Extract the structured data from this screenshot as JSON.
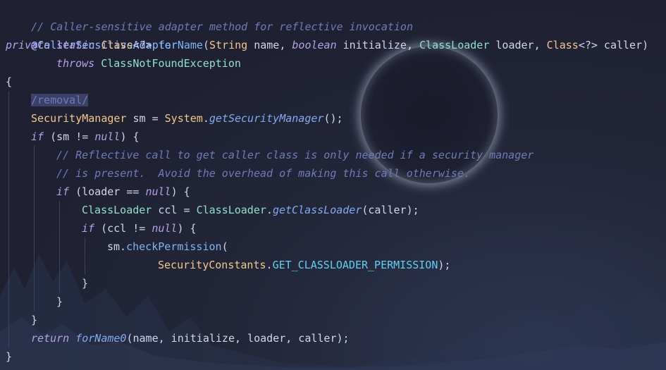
{
  "lines": {
    "l1": "// Caller-sensitive adapter method for reflective invocation",
    "l2": "@CallerSensitiveAdapter",
    "l3": {
      "kw1": "private static ",
      "t1": "Class",
      "p1": "<?> ",
      "f1": "forName",
      "p2": "(",
      "t2": "String",
      "p3": " name, ",
      "k2": "boolean",
      "p4": " initialize, ",
      "c1": "ClassLoader",
      "p5": " loader, ",
      "t3": "Class",
      "p6": "<?> caller)"
    },
    "l4": {
      "kw": "throws ",
      "c": "ClassNotFoundException"
    },
    "l5": "{",
    "l6": "/removal/",
    "l7": {
      "t": "SecurityManager",
      "p1": " sm = ",
      "t2": "System",
      "p2": ".",
      "f": "getSecurityManager",
      "p3": "();"
    },
    "l8": {
      "kw": "if",
      "p1": " (sm != ",
      "k2": "null",
      "p2": ") {"
    },
    "l9": "// Reflective call to get caller class is only needed if a security manager",
    "l10": "// is present.  Avoid the overhead of making this call otherwise.",
    "l11": {
      "kw": "if",
      "p1": " (loader == ",
      "k2": "null",
      "p2": ") {"
    },
    "l12": {
      "c1": "ClassLoader",
      "p1": " ccl = ",
      "c2": "ClassLoader",
      "p2": ".",
      "f": "getClassLoader",
      "p3": "(caller);"
    },
    "l13": {
      "kw": "if",
      "p1": " (ccl != ",
      "k2": "null",
      "p2": ") {"
    },
    "l14": {
      "p1": "sm.",
      "f": "checkPermission",
      "p2": "("
    },
    "l15": {
      "t": "SecurityConstants",
      "p1": ".",
      "k": "GET_CLASSLOADER_PERMISSION",
      "p2": ");"
    },
    "l16": "}",
    "l17": "}",
    "l18": "}",
    "l19": {
      "kw": "return ",
      "f": "forName0",
      "p": "(name, initialize, loader, caller);"
    },
    "l20": "}"
  }
}
